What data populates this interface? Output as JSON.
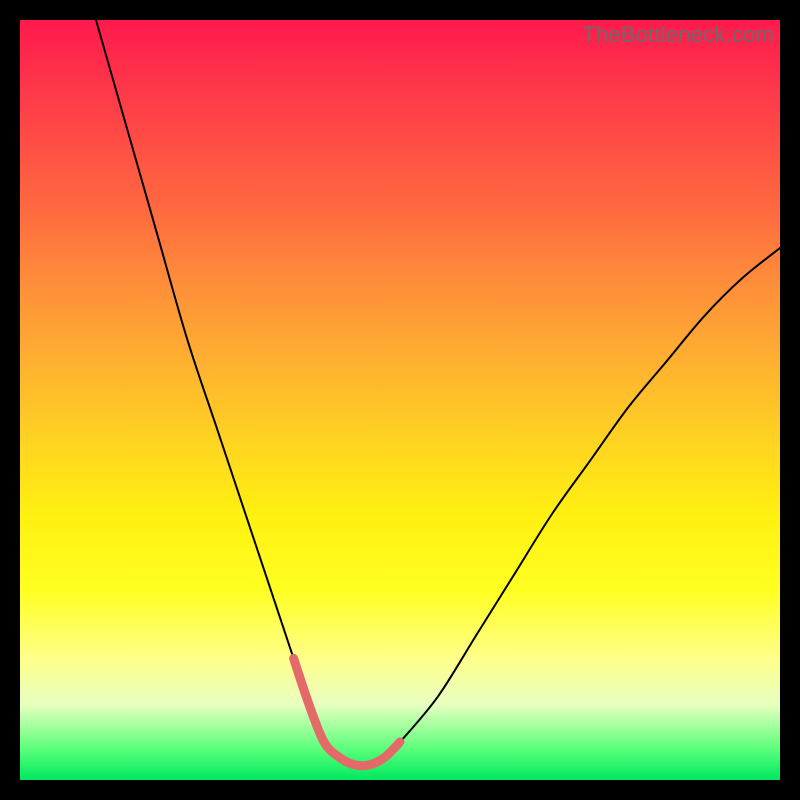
{
  "watermark": "TheBottleneck.com",
  "chart_data": {
    "type": "line",
    "title": "",
    "xlabel": "",
    "ylabel": "",
    "xlim": [
      0,
      100
    ],
    "ylim": [
      0,
      100
    ],
    "grid": false,
    "legend": false,
    "series": [
      {
        "name": "bottleneck-curve",
        "x": [
          10,
          14,
          18,
          22,
          26,
          30,
          34,
          36,
          38,
          40,
          42,
          44,
          46,
          48,
          50,
          55,
          60,
          65,
          70,
          75,
          80,
          85,
          90,
          95,
          100
        ],
        "y": [
          100,
          86,
          72,
          58,
          46,
          34,
          22,
          16,
          10,
          5,
          3,
          2,
          2,
          3,
          5,
          11,
          19,
          27,
          35,
          42,
          49,
          55,
          61,
          66,
          70
        ],
        "color": "#000000",
        "width": 2
      },
      {
        "name": "highlight-bottom",
        "x": [
          36,
          38,
          40,
          42,
          44,
          46,
          48,
          50
        ],
        "y": [
          16,
          10,
          5,
          3,
          2,
          2,
          3,
          5
        ],
        "color": "#e46a6a",
        "width": 9
      }
    ]
  }
}
